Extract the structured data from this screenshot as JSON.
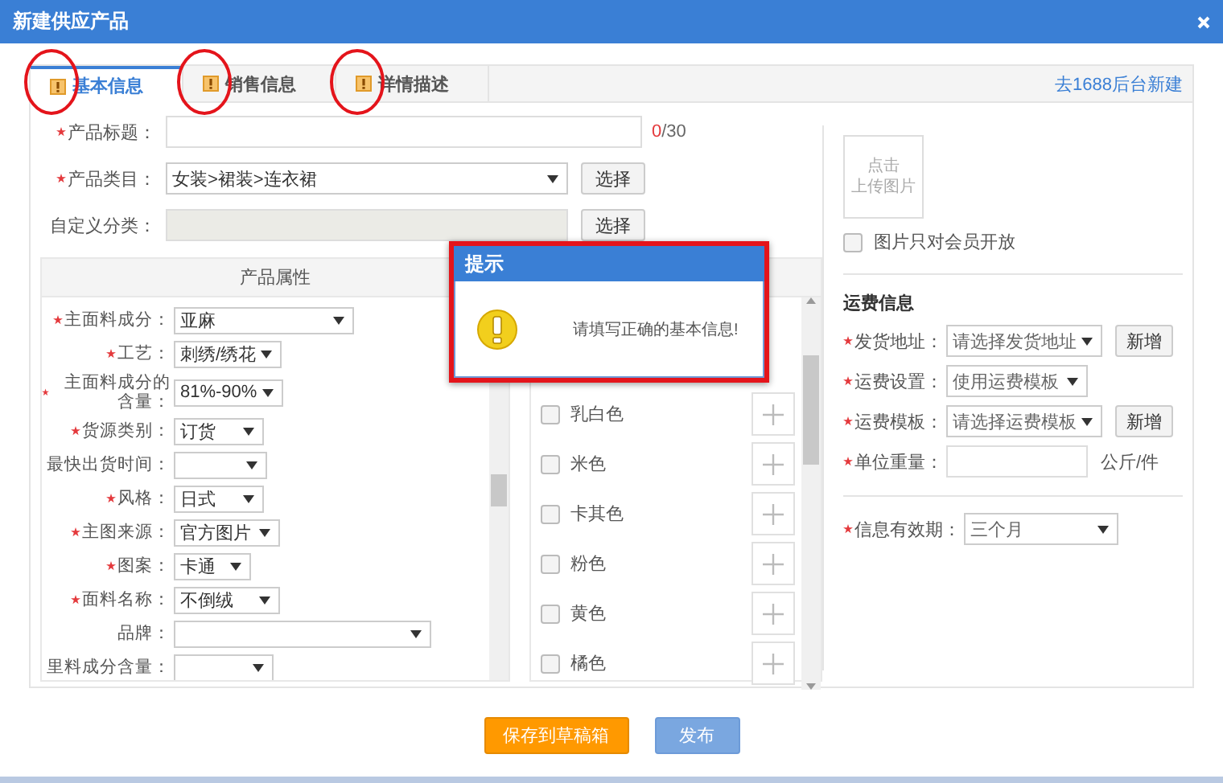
{
  "window": {
    "title": "新建供应产品"
  },
  "tabs": [
    {
      "label": "基本信息",
      "selected": true,
      "warning": true,
      "circled": true
    },
    {
      "label": "销售信息",
      "selected": false,
      "warning": true,
      "circled": true
    },
    {
      "label": "详情描述",
      "selected": false,
      "warning": true,
      "circled": true
    }
  ],
  "external_link": "去1688后台新建",
  "basic_fields": [
    {
      "kind": "text",
      "label": "产品标题：",
      "required": true,
      "counter": {
        "value": "0",
        "suffix": "/30"
      }
    },
    {
      "kind": "select",
      "label": "产品类目：",
      "required": true,
      "value": "女装>裙装>连衣裙",
      "button": "选择"
    },
    {
      "kind": "disabled",
      "label": "自定义分类：",
      "required": false,
      "button": "选择"
    }
  ],
  "attributes": {
    "title": "产品属性",
    "rows": [
      {
        "label": "主面料成分：",
        "required": true,
        "value": "亚麻"
      },
      {
        "label": "工艺：",
        "required": true,
        "value": "刺绣/绣花"
      },
      {
        "label": "主面料成分的含量：",
        "required": true,
        "value": "81%-90%"
      },
      {
        "label": "货源类别：",
        "required": true,
        "value": "订货"
      },
      {
        "label": "最快出货时间：",
        "required": false,
        "value": ""
      },
      {
        "label": "风格：",
        "required": true,
        "value": "日式"
      },
      {
        "label": "主图来源：",
        "required": true,
        "value": "官方图片"
      },
      {
        "label": "图案：",
        "required": true,
        "value": "卡通"
      },
      {
        "label": "面料名称：",
        "required": true,
        "value": "不倒绒"
      },
      {
        "label": "品牌：",
        "required": false,
        "value": ""
      },
      {
        "label": "里料成分含量：",
        "required": false,
        "value": ""
      }
    ]
  },
  "colors": [
    {
      "label": "乳白色",
      "checked": false
    },
    {
      "label": "米色",
      "checked": false
    },
    {
      "label": "卡其色",
      "checked": false
    },
    {
      "label": "粉色",
      "checked": false
    },
    {
      "label": "黄色",
      "checked": false
    },
    {
      "label": "橘色",
      "checked": false
    }
  ],
  "image_upload": {
    "lines": [
      "点击",
      "上传图片"
    ]
  },
  "members_only": {
    "label": "图片只对会员开放",
    "checked": false
  },
  "shipping": {
    "title": "运费信息",
    "fields": [
      {
        "kind": "select",
        "label": "发货地址：",
        "required": true,
        "value": "请选择发货地址",
        "button": "新增"
      },
      {
        "kind": "select",
        "label": "运费设置：",
        "required": true,
        "value": "使用运费模板"
      },
      {
        "kind": "select",
        "label": "运费模板：",
        "required": true,
        "value": "请选择运费模板",
        "button": "新增"
      },
      {
        "kind": "input",
        "label": "单位重量：",
        "required": true,
        "unit": "公斤/件"
      }
    ]
  },
  "validity": {
    "label": "信息有效期：",
    "required": true,
    "value": "三个月"
  },
  "popup": {
    "title": "提示",
    "message": "请填写正确的基本信息!",
    "highlighted": true
  },
  "buttons": [
    {
      "label": "保存到草稿箱",
      "kind": "primary"
    },
    {
      "label": "发布",
      "kind": "secondary"
    }
  ]
}
